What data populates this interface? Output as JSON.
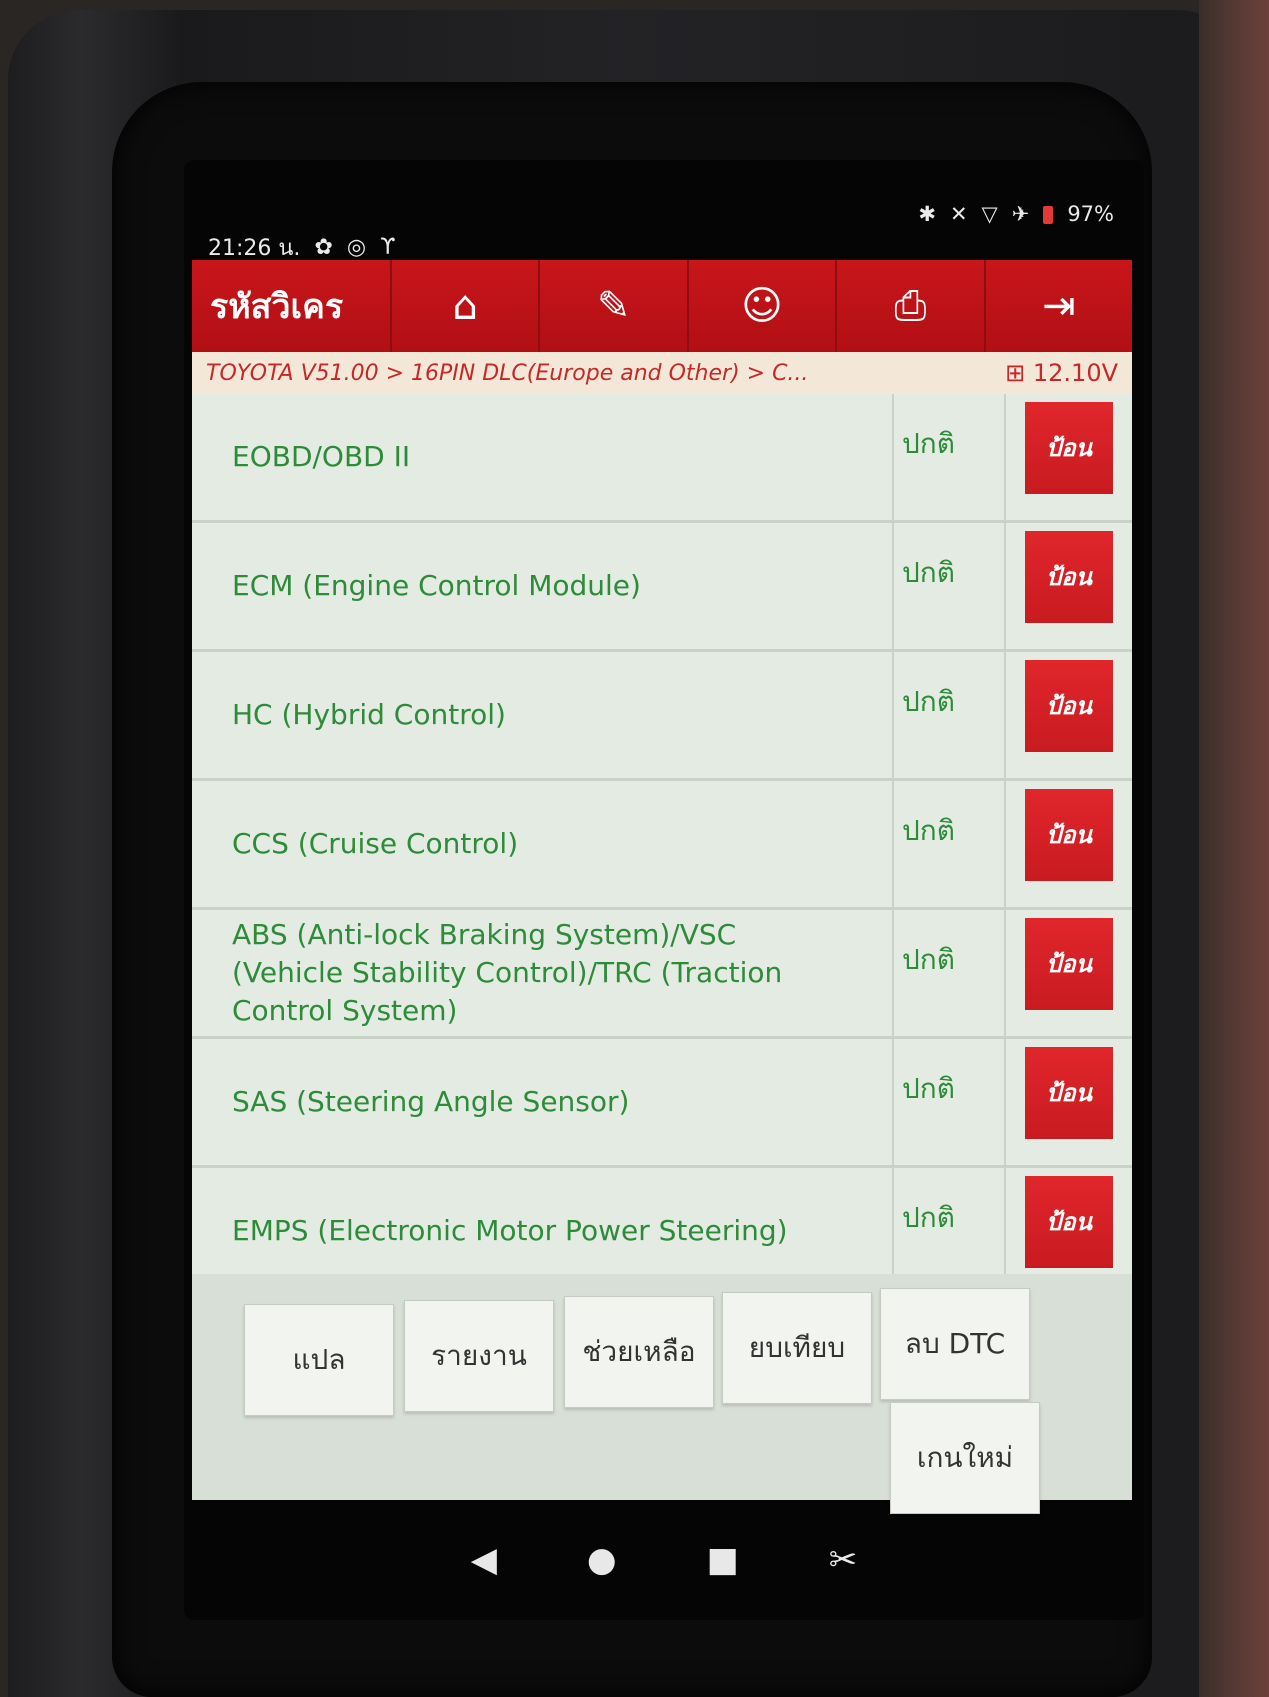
{
  "status_bar": {
    "time": "21:26 น.",
    "left_icons": [
      "gear-icon",
      "accessibility-icon",
      "stethoscope-icon"
    ],
    "right_icons": [
      "bluetooth-icon",
      "mute-icon",
      "wifi-icon",
      "airplane-icon"
    ],
    "battery": "97%"
  },
  "header": {
    "title": "รหัสวิเคร",
    "buttons": [
      {
        "name": "home-icon",
        "glyph": "⌂"
      },
      {
        "name": "edit-icon",
        "glyph": "✎"
      },
      {
        "name": "support-icon",
        "glyph": "☺"
      },
      {
        "name": "print-icon",
        "glyph": "⎙"
      },
      {
        "name": "exit-icon",
        "glyph": "⇥"
      }
    ]
  },
  "path": {
    "text": "TOYOTA V51.00 > 16PIN DLC(Europe and Other) > C...",
    "voltage": "12.10V"
  },
  "systems": [
    {
      "name": "EOBD/OBD II",
      "status": "ปกติ",
      "action": "ป้อน"
    },
    {
      "name": "ECM (Engine Control Module)",
      "status": "ปกติ",
      "action": "ป้อน"
    },
    {
      "name": "HC (Hybrid Control)",
      "status": "ปกติ",
      "action": "ป้อน"
    },
    {
      "name": "CCS (Cruise Control)",
      "status": "ปกติ",
      "action": "ป้อน"
    },
    {
      "name": "ABS (Anti-lock Braking System)/VSC (Vehicle Stability Control)/TRC (Traction Control System)",
      "status": "ปกติ",
      "action": "ป้อน"
    },
    {
      "name": "SAS (Steering Angle Sensor)",
      "status": "ปกติ",
      "action": "ป้อน"
    },
    {
      "name": "EMPS (Electronic Motor Power Steering)",
      "status": "ปกติ",
      "action": "ป้อน"
    }
  ],
  "toolbar": {
    "translate": "แปล",
    "report": "รายงาน",
    "help": "ช่วยเหลือ",
    "compare": "ยบเทียบ",
    "clear_dtc": "ลบ DTC",
    "rescan": "เกนใหม่"
  },
  "nav": {
    "back": "◀",
    "home": "●",
    "recents": "■",
    "screenshot": "✂"
  }
}
